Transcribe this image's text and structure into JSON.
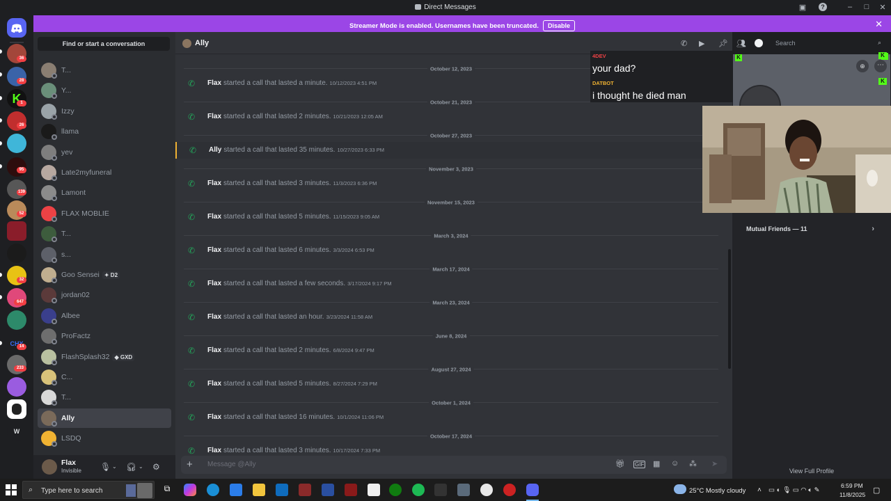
{
  "window": {
    "title": "Direct Messages"
  },
  "banner": {
    "text": "Streamer Mode is enabled. Usernames have been truncated.",
    "button": "Disable"
  },
  "guild_badges": [
    "36",
    "28",
    "1",
    "26",
    "95",
    "139",
    "52",
    "32",
    "647",
    "14",
    "233"
  ],
  "guild_text": {
    "chx": "CHX",
    "w": "W"
  },
  "find_conversation": "Find or start a conversation",
  "dms": [
    {
      "name": "T...",
      "color": "#8a7e72"
    },
    {
      "name": "Y...",
      "color": "#6a8f7a"
    },
    {
      "name": "Izzy",
      "color": "#9aa3a8"
    },
    {
      "name": "llama",
      "color": "#1a1a1a"
    },
    {
      "name": "yev",
      "color": "#7e7e7e"
    },
    {
      "name": "Late2myfuneral",
      "color": "#b7a8a0"
    },
    {
      "name": "Lamont",
      "color": "#8b8b8b"
    },
    {
      "name": "FLAX MOBLIE",
      "color": "#ed4245"
    },
    {
      "name": "T...",
      "color": "#3d5c3d"
    },
    {
      "name": "s...",
      "color": "#5d6069"
    },
    {
      "name": "Goo Sensei",
      "color": "#c0ae8f",
      "tag": "✦ D2"
    },
    {
      "name": "jordan02",
      "color": "#5b3a3a"
    },
    {
      "name": "Albee",
      "color": "#3a3f8c"
    },
    {
      "name": "ProFactz",
      "color": "#6e6e6e"
    },
    {
      "name": "FlashSplash32",
      "color": "#b9c0a0",
      "tag": "◆ GXD"
    },
    {
      "name": "C...",
      "color": "#d8c27a"
    },
    {
      "name": "T...",
      "color": "#d9d9d9"
    },
    {
      "name": "Ally",
      "color": "#7a6a5a",
      "selected": true
    },
    {
      "name": "LSDQ",
      "color": "#f0b232"
    }
  ],
  "user": {
    "name": "Flax",
    "status": "Invisible"
  },
  "chat": {
    "recipient": "Ally",
    "search_placeholder": "Search",
    "composer_placeholder": "Message @Ally",
    "messages": [
      {
        "date": "October 12, 2023",
        "caller": "Flax",
        "text": "started a call that lasted a minute.",
        "time": "10/12/2023 4:51 PM"
      },
      {
        "date": "October 21, 2023",
        "caller": "Flax",
        "text": "started a call that lasted 2 minutes.",
        "time": "10/21/2023 12:05 AM"
      },
      {
        "date": "October 27, 2023",
        "caller": "Ally",
        "text": "started a call that lasted 35 minutes.",
        "time": "10/27/2023 6:33 PM",
        "highlight": true
      },
      {
        "date": "November 3, 2023",
        "caller": "Flax",
        "text": "started a call that lasted 3 minutes.",
        "time": "11/3/2023 6:36 PM"
      },
      {
        "date": "November 15, 2023",
        "caller": "Flax",
        "text": "started a call that lasted 5 minutes.",
        "time": "11/15/2023 9:05 AM"
      },
      {
        "date": "March 3, 2024",
        "caller": "Flax",
        "text": "started a call that lasted 6 minutes.",
        "time": "3/3/2024 6:53 PM"
      },
      {
        "date": "March 17, 2024",
        "caller": "Flax",
        "text": "started a call that lasted a few seconds.",
        "time": "3/17/2024 9:17 PM"
      },
      {
        "date": "March 23, 2024",
        "caller": "Flax",
        "text": "started a call that lasted an hour.",
        "time": "3/23/2024 11:58 AM"
      },
      {
        "date": "June 8, 2024",
        "caller": "Flax",
        "text": "started a call that lasted 2 minutes.",
        "time": "6/8/2024 9:47 PM"
      },
      {
        "date": "August 27, 2024",
        "caller": "Flax",
        "text": "started a call that lasted 5 minutes.",
        "time": "8/27/2024 7:29 PM"
      },
      {
        "date": "October 1, 2024",
        "caller": "Flax",
        "text": "started a call that lasted 16 minutes.",
        "time": "10/1/2024 11:06 PM"
      },
      {
        "date": "October 17, 2024",
        "caller": "Flax",
        "text": "started a call that lasted 3 minutes.",
        "time": "10/17/2024 7:33 PM"
      }
    ]
  },
  "overlay": [
    {
      "name": "4DEV",
      "message": "your dad?",
      "color": "#ed4245"
    },
    {
      "name": "DATBOT",
      "message": "i thought he died man",
      "color": "#f0b232"
    }
  ],
  "profile": {
    "mutual_friends": "Mutual Friends — 11",
    "view_full": "View Full Profile"
  },
  "taskbar": {
    "search_placeholder": "Type here to search",
    "weather": "25°C  Mostly cloudy",
    "time": "6:59 PM",
    "date": "11/8/2025"
  }
}
